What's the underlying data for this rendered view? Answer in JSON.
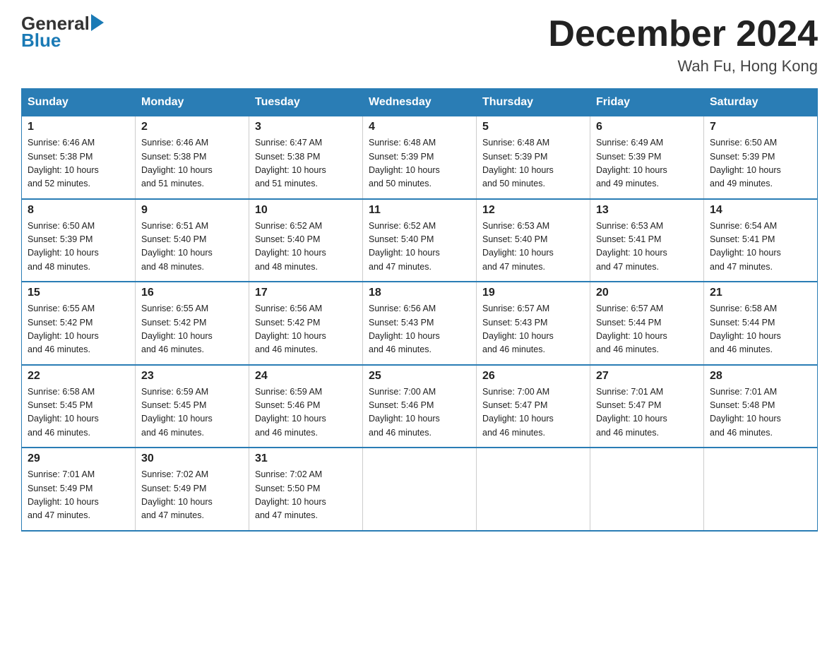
{
  "header": {
    "logo_general": "General",
    "logo_blue": "Blue",
    "month_title": "December 2024",
    "location": "Wah Fu, Hong Kong"
  },
  "days_of_week": [
    "Sunday",
    "Monday",
    "Tuesday",
    "Wednesday",
    "Thursday",
    "Friday",
    "Saturday"
  ],
  "weeks": [
    [
      {
        "day": "1",
        "sunrise": "6:46 AM",
        "sunset": "5:38 PM",
        "daylight": "10 hours and 52 minutes."
      },
      {
        "day": "2",
        "sunrise": "6:46 AM",
        "sunset": "5:38 PM",
        "daylight": "10 hours and 51 minutes."
      },
      {
        "day": "3",
        "sunrise": "6:47 AM",
        "sunset": "5:38 PM",
        "daylight": "10 hours and 51 minutes."
      },
      {
        "day": "4",
        "sunrise": "6:48 AM",
        "sunset": "5:39 PM",
        "daylight": "10 hours and 50 minutes."
      },
      {
        "day": "5",
        "sunrise": "6:48 AM",
        "sunset": "5:39 PM",
        "daylight": "10 hours and 50 minutes."
      },
      {
        "day": "6",
        "sunrise": "6:49 AM",
        "sunset": "5:39 PM",
        "daylight": "10 hours and 49 minutes."
      },
      {
        "day": "7",
        "sunrise": "6:50 AM",
        "sunset": "5:39 PM",
        "daylight": "10 hours and 49 minutes."
      }
    ],
    [
      {
        "day": "8",
        "sunrise": "6:50 AM",
        "sunset": "5:39 PM",
        "daylight": "10 hours and 48 minutes."
      },
      {
        "day": "9",
        "sunrise": "6:51 AM",
        "sunset": "5:40 PM",
        "daylight": "10 hours and 48 minutes."
      },
      {
        "day": "10",
        "sunrise": "6:52 AM",
        "sunset": "5:40 PM",
        "daylight": "10 hours and 48 minutes."
      },
      {
        "day": "11",
        "sunrise": "6:52 AM",
        "sunset": "5:40 PM",
        "daylight": "10 hours and 47 minutes."
      },
      {
        "day": "12",
        "sunrise": "6:53 AM",
        "sunset": "5:40 PM",
        "daylight": "10 hours and 47 minutes."
      },
      {
        "day": "13",
        "sunrise": "6:53 AM",
        "sunset": "5:41 PM",
        "daylight": "10 hours and 47 minutes."
      },
      {
        "day": "14",
        "sunrise": "6:54 AM",
        "sunset": "5:41 PM",
        "daylight": "10 hours and 47 minutes."
      }
    ],
    [
      {
        "day": "15",
        "sunrise": "6:55 AM",
        "sunset": "5:42 PM",
        "daylight": "10 hours and 46 minutes."
      },
      {
        "day": "16",
        "sunrise": "6:55 AM",
        "sunset": "5:42 PM",
        "daylight": "10 hours and 46 minutes."
      },
      {
        "day": "17",
        "sunrise": "6:56 AM",
        "sunset": "5:42 PM",
        "daylight": "10 hours and 46 minutes."
      },
      {
        "day": "18",
        "sunrise": "6:56 AM",
        "sunset": "5:43 PM",
        "daylight": "10 hours and 46 minutes."
      },
      {
        "day": "19",
        "sunrise": "6:57 AM",
        "sunset": "5:43 PM",
        "daylight": "10 hours and 46 minutes."
      },
      {
        "day": "20",
        "sunrise": "6:57 AM",
        "sunset": "5:44 PM",
        "daylight": "10 hours and 46 minutes."
      },
      {
        "day": "21",
        "sunrise": "6:58 AM",
        "sunset": "5:44 PM",
        "daylight": "10 hours and 46 minutes."
      }
    ],
    [
      {
        "day": "22",
        "sunrise": "6:58 AM",
        "sunset": "5:45 PM",
        "daylight": "10 hours and 46 minutes."
      },
      {
        "day": "23",
        "sunrise": "6:59 AM",
        "sunset": "5:45 PM",
        "daylight": "10 hours and 46 minutes."
      },
      {
        "day": "24",
        "sunrise": "6:59 AM",
        "sunset": "5:46 PM",
        "daylight": "10 hours and 46 minutes."
      },
      {
        "day": "25",
        "sunrise": "7:00 AM",
        "sunset": "5:46 PM",
        "daylight": "10 hours and 46 minutes."
      },
      {
        "day": "26",
        "sunrise": "7:00 AM",
        "sunset": "5:47 PM",
        "daylight": "10 hours and 46 minutes."
      },
      {
        "day": "27",
        "sunrise": "7:01 AM",
        "sunset": "5:47 PM",
        "daylight": "10 hours and 46 minutes."
      },
      {
        "day": "28",
        "sunrise": "7:01 AM",
        "sunset": "5:48 PM",
        "daylight": "10 hours and 46 minutes."
      }
    ],
    [
      {
        "day": "29",
        "sunrise": "7:01 AM",
        "sunset": "5:49 PM",
        "daylight": "10 hours and 47 minutes."
      },
      {
        "day": "30",
        "sunrise": "7:02 AM",
        "sunset": "5:49 PM",
        "daylight": "10 hours and 47 minutes."
      },
      {
        "day": "31",
        "sunrise": "7:02 AM",
        "sunset": "5:50 PM",
        "daylight": "10 hours and 47 minutes."
      },
      null,
      null,
      null,
      null
    ]
  ],
  "labels": {
    "sunrise": "Sunrise:",
    "sunset": "Sunset:",
    "daylight": "Daylight:"
  }
}
